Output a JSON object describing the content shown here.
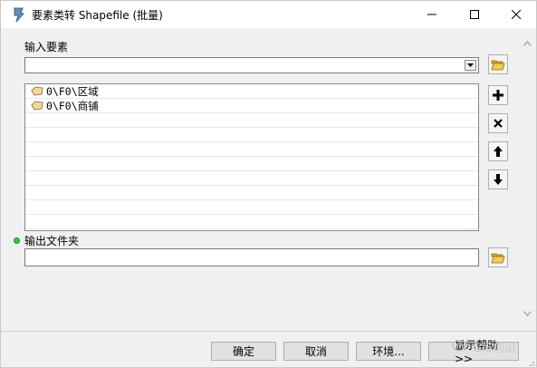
{
  "window": {
    "title": "要素类转 Shapefile (批量)",
    "app_icon": "arcgis-toolbox-icon",
    "controls": [
      "minimize-icon",
      "maximize-icon",
      "close-icon"
    ]
  },
  "form": {
    "input_features_label": "输入要素",
    "input_features_value": "",
    "feature_list": [
      {
        "label": "0\\F0\\区域",
        "icon": "polygon-feature-icon"
      },
      {
        "label": "0\\F0\\商铺",
        "icon": "polygon-feature-icon"
      }
    ],
    "output_folder_label": "输出文件夹",
    "output_folder_value": "",
    "side_buttons": [
      "open-folder-icon",
      "add-icon",
      "remove-icon",
      "move-up-icon",
      "move-down-icon",
      "open-folder-icon"
    ]
  },
  "footer": {
    "ok_label": "确定",
    "cancel_label": "取消",
    "env_label": "环境...",
    "help_label": "显示帮助 >>"
  },
  "watermark": {
    "text": "GIS前沿"
  },
  "colors": {
    "required_dot": "#35c635",
    "folder_yellow": "#e8b830",
    "polygon_fill": "#f0d9a0"
  }
}
